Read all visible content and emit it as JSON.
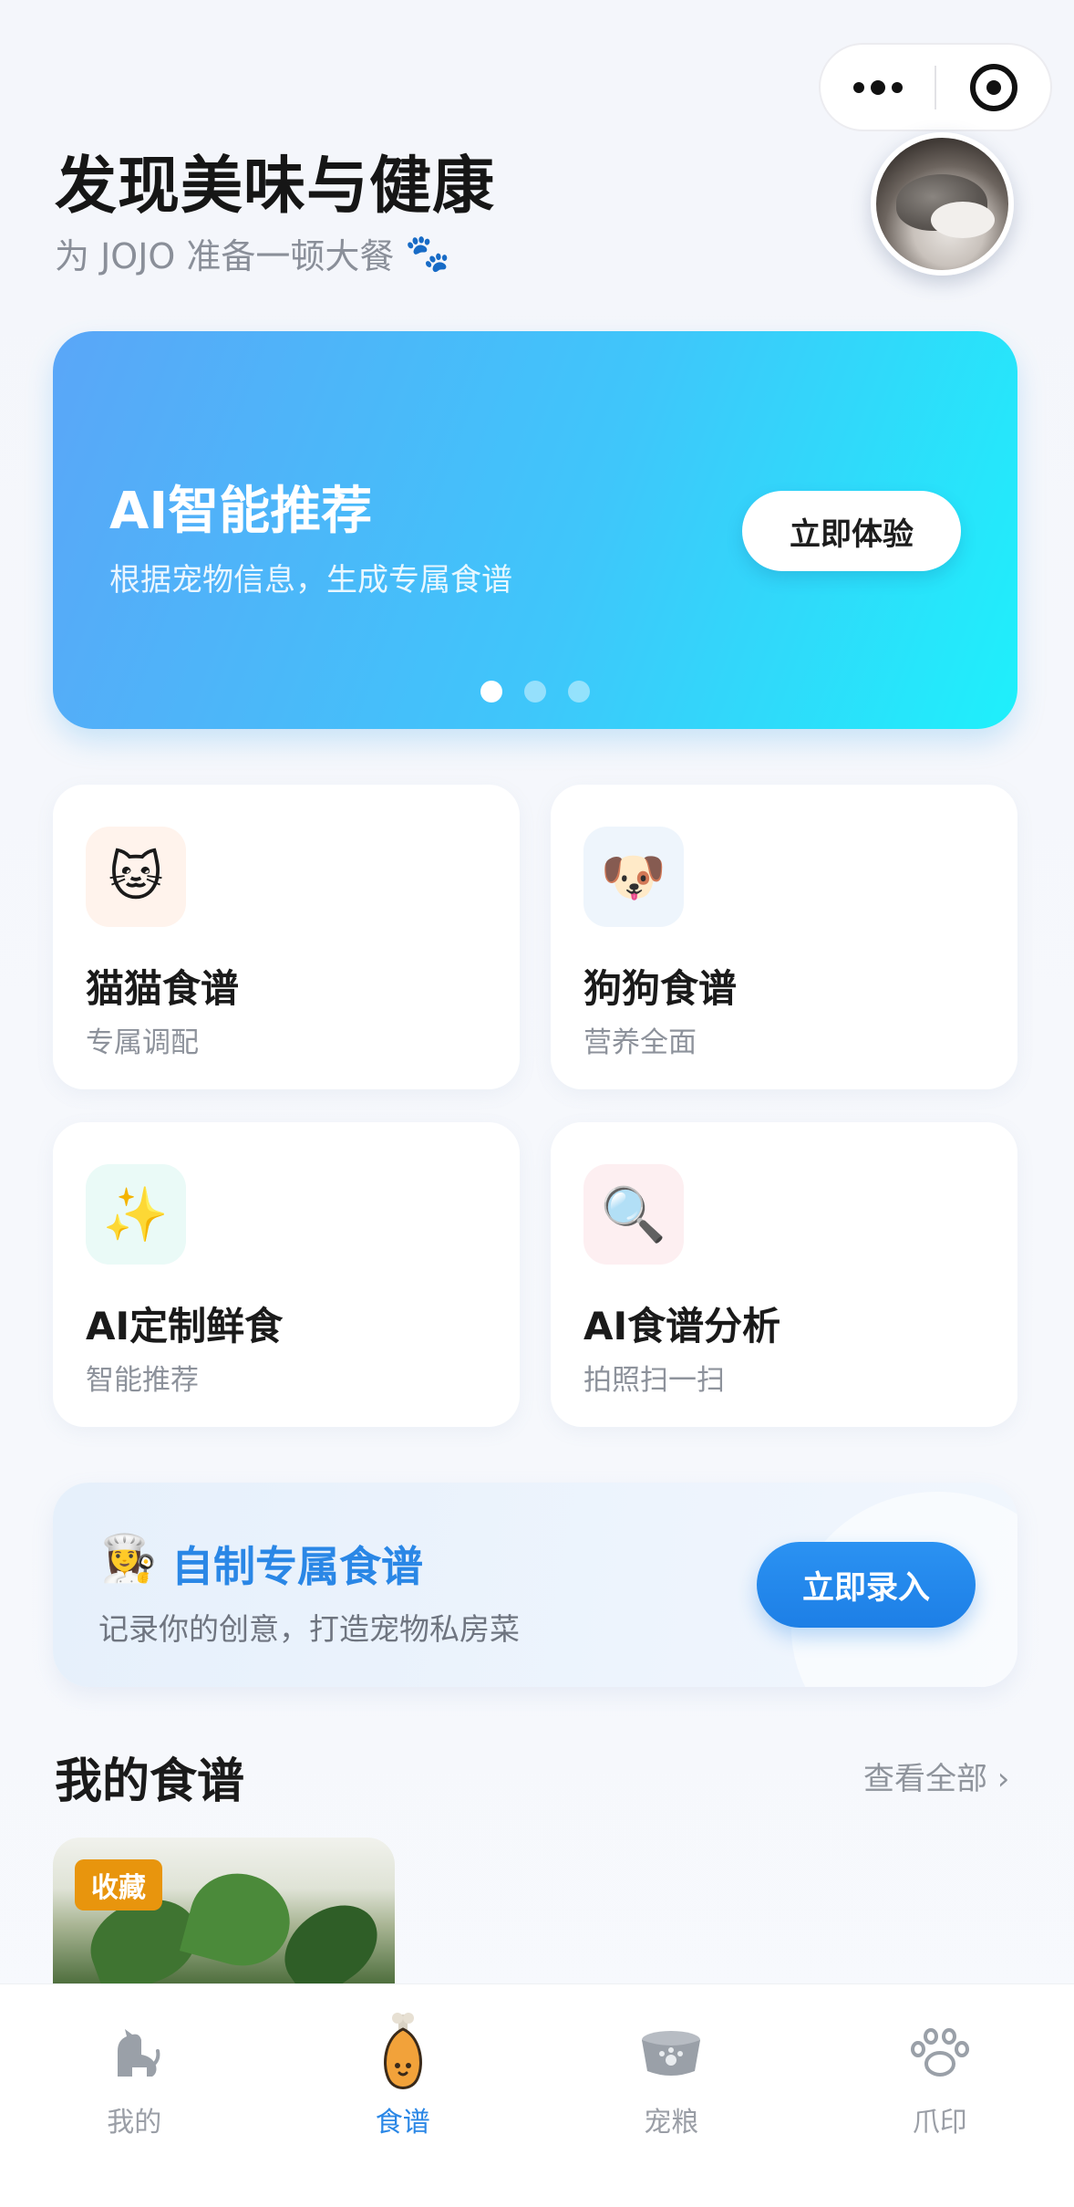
{
  "header": {
    "title": "发现美味与健康",
    "subtitle": "为 JOJO 准备一顿大餐",
    "subtitle_icon": "paw-icon"
  },
  "capsule": {
    "more_icon": "more-dots-icon",
    "close_icon": "target-icon"
  },
  "avatar": {
    "alt": "cat-avatar"
  },
  "banner": {
    "title": "AI智能推荐",
    "subtitle": "根据宠物信息，生成专属食谱",
    "button": "立即体验",
    "active_slide": 1,
    "slides": 3
  },
  "categories": [
    {
      "icon": "🐱",
      "icon_name": "cat-face-icon",
      "title": "猫猫食谱",
      "desc": "专属调配",
      "bg": "#fff3ec"
    },
    {
      "icon": "🐶",
      "icon_name": "dog-face-icon",
      "title": "狗狗食谱",
      "desc": "营养全面",
      "bg": "#eef5fc"
    },
    {
      "icon": "✨",
      "icon_name": "sparkles-icon",
      "title": "AI定制鲜食",
      "desc": "智能推荐",
      "bg": "#eafaf7"
    },
    {
      "icon": "🔍",
      "icon_name": "magnifier-icon",
      "title": "AI食谱分析",
      "desc": "拍照扫一扫",
      "bg": "#fdeff1"
    }
  ],
  "custom": {
    "icon": "👩‍🍳",
    "title": "自制专属食谱",
    "subtitle": "记录你的创意，打造宠物私房菜",
    "button": "立即录入"
  },
  "my_recipes": {
    "title": "我的食谱",
    "see_all": "查看全部 ›",
    "items": [
      {
        "badge": "收藏"
      }
    ]
  },
  "tabbar": {
    "tabs": [
      {
        "label": "我的",
        "icon": "dog-silhouette-icon"
      },
      {
        "label": "食谱",
        "icon": "drumstick-icon",
        "active": true
      },
      {
        "label": "宠粮",
        "icon": "pet-bowl-icon"
      },
      {
        "label": "爪印",
        "icon": "pawprint-icon"
      }
    ]
  },
  "colors": {
    "accent": "#2a87e6",
    "badge": "#e8950d"
  }
}
